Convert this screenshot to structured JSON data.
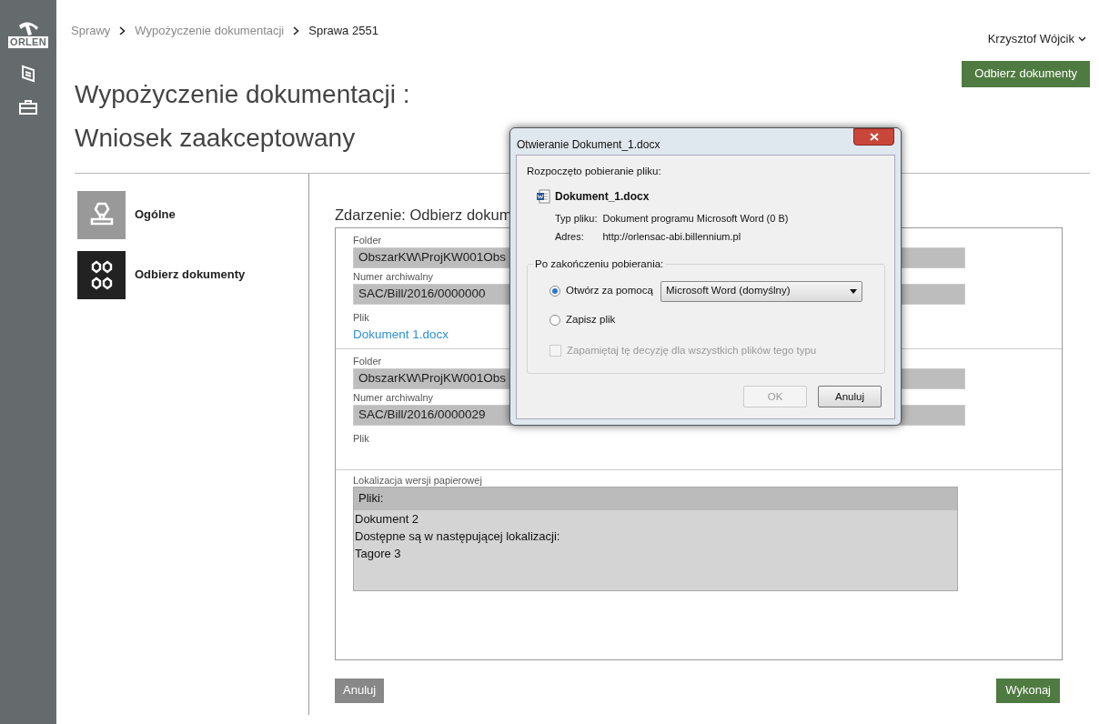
{
  "sidebar": {
    "logo": "ORLEN"
  },
  "breadcrumb": [
    {
      "label": "Sprawy",
      "current": false
    },
    {
      "label": "Wypożyczenie dokumentacji",
      "current": false
    },
    {
      "label": "Sprawa 2551",
      "current": true
    }
  ],
  "user": {
    "name": "Krzysztof Wójcik"
  },
  "primary_button": "Odbierz dokumenty",
  "title": [
    "Wypożyczenie dokumentacji :",
    "Wniosek zaakceptowany"
  ],
  "steps": [
    {
      "kind": "stamp",
      "label": "Ogólne",
      "selected": false
    },
    {
      "kind": "hexagons",
      "label": "Odbierz dokumenty",
      "selected": true
    }
  ],
  "event": {
    "heading": "Zdarzenie: Odbierz dokum",
    "records": [
      {
        "fields": [
          {
            "label": "Folder",
            "value": "ObszarKW\\ProjKW001Obs"
          },
          {
            "label": "Numer archiwalny",
            "value": "SAC/Bill/2016/0000000"
          }
        ],
        "file_label": "Plik",
        "file_link": "Dokument 1.docx"
      },
      {
        "fields": [
          {
            "label": "Folder",
            "value": "ObszarKW\\ProjKW001Obs"
          },
          {
            "label": "Numer archiwalny",
            "value": "SAC/Bill/2016/0000029"
          }
        ],
        "file_label": "Plik"
      }
    ],
    "paper_location": {
      "label": "Lokalizacja wersji papierowej",
      "header": "Pliki:",
      "lines": [
        "Dokument 2",
        "Dostępne są w następującej lokalizacji:",
        "Tagore 3"
      ]
    }
  },
  "cancel_button": "Anuluj",
  "submit_button": "Wykonaj",
  "dialog": {
    "title": "Otwieranie Dokument_1.docx",
    "intro": "Rozpoczęto pobieranie pliku:",
    "file_name": "Dokument_1.docx",
    "details": [
      {
        "label": "Typ pliku:",
        "value": "Dokument programu Microsoft Word (0 B)"
      },
      {
        "label": "Adres:",
        "value": "http://orlensac-abi.billennium.pl"
      }
    ],
    "group_label": "Po zakończeniu pobierania:",
    "options": [
      {
        "label": "Otwórz za pomocą",
        "selected": true
      },
      {
        "label": "Zapisz plik",
        "selected": false
      }
    ],
    "open_with": "Microsoft Word (domyślny)",
    "remember": {
      "label": "Zapamiętaj tę decyzję dla wszystkich plików tego typu",
      "checked": false,
      "disabled": true
    },
    "ok": {
      "label": "OK",
      "disabled": true
    },
    "cancel": {
      "label": "Anuluj",
      "disabled": false
    }
  }
}
